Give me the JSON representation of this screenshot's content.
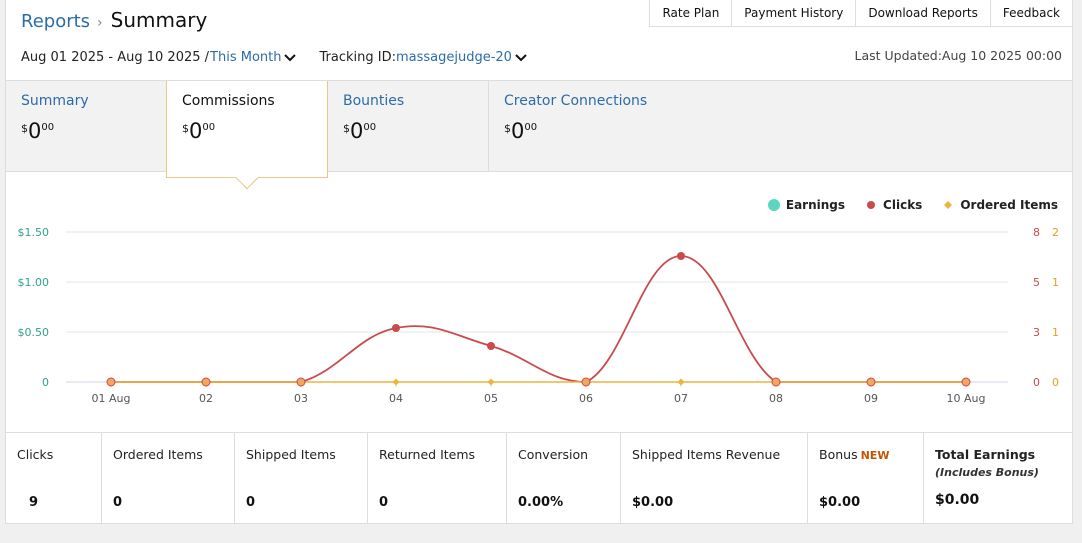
{
  "header": {
    "breadcrumb_link": "Reports",
    "breadcrumb_sep": "›",
    "title": "Summary",
    "links": [
      "Rate Plan",
      "Payment History",
      "Download Reports",
      "Feedback"
    ]
  },
  "filters": {
    "date_range": "Aug 01 2025 - Aug 10 2025 /",
    "date_preset": "This Month",
    "tracking_label": "Tracking ID:",
    "tracking_value": "massagejudge-20",
    "last_updated": "Last Updated:Aug 10 2025 00:00"
  },
  "tabs": [
    {
      "label": "Summary",
      "currency": "$",
      "whole": "0",
      "cents": "00",
      "active": false
    },
    {
      "label": "Commissions",
      "currency": "$",
      "whole": "0",
      "cents": "00",
      "active": true
    },
    {
      "label": "Bounties",
      "currency": "$",
      "whole": "0",
      "cents": "00",
      "active": false
    },
    {
      "label": "Creator Connections",
      "currency": "$",
      "whole": "0",
      "cents": "00",
      "active": false
    }
  ],
  "chart_data": {
    "type": "line",
    "categories": [
      "01 Aug",
      "02",
      "03",
      "04",
      "05",
      "06",
      "07",
      "08",
      "09",
      "10 Aug"
    ],
    "series": [
      {
        "name": "Earnings",
        "color": "#5cd6c0",
        "axis": "left",
        "values": [
          0,
          0,
          0,
          0,
          0,
          0,
          0,
          0,
          0,
          0
        ]
      },
      {
        "name": "Clicks",
        "color": "#c94b4b",
        "axis": "right1",
        "values": [
          0,
          0,
          0,
          3,
          2,
          0,
          7,
          0,
          0,
          0
        ]
      },
      {
        "name": "Ordered Items",
        "color": "#f0b43c",
        "axis": "right2",
        "values": [
          0,
          0,
          0,
          0,
          0,
          0,
          0,
          0,
          0,
          0
        ]
      }
    ],
    "left_axis": {
      "ticks": [
        "0",
        "$0.50",
        "$1.00",
        "$1.50"
      ],
      "values": [
        0,
        0.5,
        1.0,
        1.5
      ],
      "color": "#2fa38c"
    },
    "right1_axis": {
      "ticks": [
        "0",
        "3",
        "5",
        "8"
      ],
      "color": "#c94b4b"
    },
    "right2_axis": {
      "ticks": [
        "0",
        "1",
        "1",
        "2"
      ],
      "color": "#e0a020"
    },
    "ylim": [
      0,
      1.5
    ],
    "legend": "top-right",
    "grid": true
  },
  "stats": [
    {
      "label": "Clicks",
      "value": "9"
    },
    {
      "label": "Ordered Items",
      "value": "0"
    },
    {
      "label": "Shipped Items",
      "value": "0"
    },
    {
      "label": "Returned Items",
      "value": "0"
    },
    {
      "label": "Conversion",
      "value": "0.00%"
    },
    {
      "label": "Shipped Items Revenue",
      "value": "$0.00"
    },
    {
      "label": "Bonus",
      "badge": "NEW",
      "value": "$0.00"
    },
    {
      "label": "Total Earnings",
      "sub": "(Includes Bonus)",
      "value": "$0.00"
    }
  ]
}
